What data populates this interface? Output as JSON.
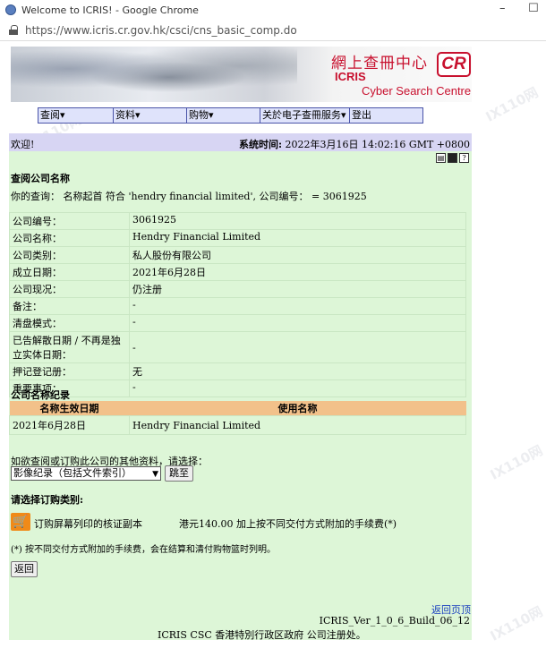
{
  "window": {
    "title": "Welcome to ICRIS! - Google Chrome",
    "url": "https://www.icris.cr.gov.hk/csci/cns_basic_comp.do",
    "minimize_glyph": "–",
    "maximize_glyph": "☐"
  },
  "banner": {
    "chinese_title": "網上查冊中心",
    "icris": "ICRIS",
    "cyber": "Cyber Search Centre",
    "logo": "CR"
  },
  "menu": [
    {
      "label": "查阅▾"
    },
    {
      "label": "资料▾"
    },
    {
      "label": "购物▾"
    },
    {
      "label": "关於电子查冊服务▾"
    },
    {
      "label": "登出"
    }
  ],
  "status": {
    "welcome": "欢迎!",
    "time_label": "系统时间:",
    "time_value": "2022年3月16日 14:02:16 GMT +0800"
  },
  "tool_icons": [
    "print-icon",
    "save-icon",
    "help-icon"
  ],
  "section_title": "查阅公司名称",
  "query_text": "你的查询： 名称起首 符合 'hendry financial limited', 公司编号： = 3061925",
  "info_rows": [
    {
      "k": "公司编号：",
      "v": "3061925"
    },
    {
      "k": "公司名称：",
      "v": "Hendry Financial Limited"
    },
    {
      "k": "公司类别：",
      "v": "私人股份有限公司"
    },
    {
      "k": "成立日期：",
      "v": "2021年6月28日"
    },
    {
      "k": "公司现况：",
      "v": "仍注册"
    },
    {
      "k": "备注：",
      "v": "-"
    },
    {
      "k": "清盘模式：",
      "v": "-"
    },
    {
      "k": "已告解散日期 / 不再是独立实体日期：",
      "v": "-"
    },
    {
      "k": "押记登记册：",
      "v": "无"
    },
    {
      "k": "重要事项：",
      "v": "-"
    }
  ],
  "history": {
    "title": "公司名称纪录",
    "headers": [
      "名称生效日期",
      "使用名称"
    ],
    "rows": [
      {
        "date": "2021年6月28日",
        "name": "Hendry Financial Limited"
      }
    ]
  },
  "more": {
    "label": "如欲查阅或订购此公司的其他资料，请选择：",
    "select_value": "影像纪录（包括文件索引）",
    "go_button": "跳至"
  },
  "order": {
    "title": "请选择订购类别:",
    "item_label": "订购屏幕列印的核证副本",
    "fee": "港元140.00 加上按不同交付方式附加的手续费(*)",
    "note": "(*) 按不同交付方式附加的手续费，会在结算和清付购物篮时列明。",
    "back_button": "返回"
  },
  "footer": {
    "back_to_top": "返回页顶",
    "build": "ICRIS_Ver_1_0_6_Build_06_12",
    "copyright": "ICRIS CSC 香港特別行政区政府 公司注册处。"
  }
}
